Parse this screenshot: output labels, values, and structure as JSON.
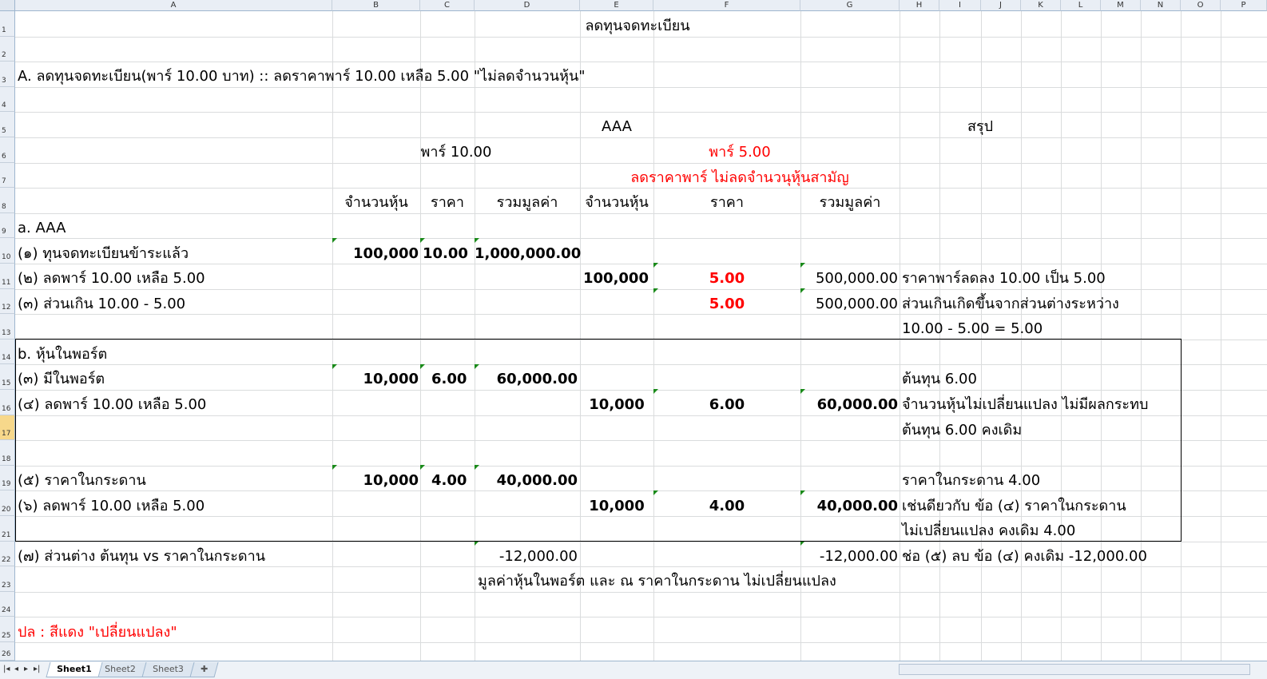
{
  "columns": [
    "A",
    "B",
    "C",
    "D",
    "E",
    "F",
    "G",
    "H",
    "I",
    "J",
    "K",
    "L",
    "M",
    "N",
    "O",
    "P"
  ],
  "rows": [
    "1",
    "2",
    "3",
    "4",
    "5",
    "6",
    "7",
    "8",
    "9",
    "10",
    "11",
    "12",
    "13",
    "14",
    "15",
    "16",
    "17",
    "18",
    "19",
    "20",
    "21",
    "22",
    "23",
    "24",
    "25",
    "26"
  ],
  "cells": {
    "title": "ลดทุนจดทะเบียน",
    "section_a_heading": "A. ลดทุนจดทะเบียน(พาร์ 10.00 บาท) ::   ลดราคาพาร์ 10.00 เหลือ 5.00  \"ไม่ลดจำนวนหุ้น\"",
    "aaa_header": "AAA",
    "summary_header": "สรุป",
    "par_old": "พาร์ 10.00",
    "par_new": "พาร์ 5.00",
    "par_note": "ลดราคาพาร์ ไม่ลดจำนวนุหุ้นสามัญ",
    "hdr_shares_1": "จำนวนหุ้น",
    "hdr_price_1": "ราคา",
    "hdr_total_1": "รวมมูลค่า",
    "hdr_shares_2": "จำนวนหุ้น",
    "hdr_price_2": "ราคา",
    "hdr_total_2": "รวมมูลค่า",
    "a9": "a. AAA",
    "a10": "(๑) ทุนจดทะเบียนข้าระแล้ว",
    "b10": "100,000",
    "c10": "10.00",
    "d10": "1,000,000.00",
    "a11": "(๒) ลดพาร์ 10.00 เหลือ 5.00",
    "e11": "100,000",
    "f11": "5.00",
    "g11": "500,000.00",
    "h11": "ราคาพาร์ลดลง 10.00 เป็น 5.00",
    "a12": "(๓) ส่วนเกิน 10.00 - 5.00",
    "f12": "5.00",
    "g12": "500,000.00",
    "h12": "ส่วนเกินเกิดขึ้นจากส่วนต่างระหว่าง",
    "h13": "10.00 - 5.00 = 5.00",
    "a14": "b. หุ้นในพอร์ต",
    "a15": "(๓) มีในพอร์ต",
    "b15": "10,000",
    "c15": "6.00",
    "d15": "60,000.00",
    "h15": "ต้นทุน 6.00",
    "a16": "(๔) ลดพาร์ 10.00 เหลือ 5.00",
    "e16": "10,000",
    "f16": "6.00",
    "g16": "60,000.00",
    "h16": "จำนวนหุ้นไม่เปลี่ยนแปลง ไม่มีผลกระทบ",
    "h17": "ต้นทุน 6.00 คงเดิม",
    "a19": "(๕) ราคาในกระดาน",
    "b19": "10,000",
    "c19": "4.00",
    "d19": "40,000.00",
    "h19": "ราคาในกระดาน 4.00",
    "a20": "(๖) ลดพาร์ 10.00 เหลือ 5.00",
    "e20": "10,000",
    "f20": "4.00",
    "g20": "40,000.00",
    "h20": "เช่นดียวกับ ข้อ (๔)  ราคาในกระดาน",
    "h21": "ไม่เปลี่ยนแปลง คงเดิม 4.00",
    "a22": "(๗) ส่วนต่าง ต้นทุน vs ราคาในกระดาน",
    "d22": "-12,000.00",
    "g22": "-12,000.00",
    "h22": "ช่อ (๕) ลบ ข้อ (๔) คงเดิม -12,000.00",
    "d23": "มูลค่าหุ้นในพอร์ต และ ณ ราคาในกระดาน ไม่เปลี่ยนแปลง",
    "a25": "ปล :  สีแดง \"เปลี่ยนแปลง\""
  },
  "sheet_tabs": [
    "Sheet1",
    "Sheet2",
    "Sheet3"
  ],
  "active_tab": "Sheet1",
  "colors": {
    "red": "#ff0000",
    "header_bg": "#e9eef5",
    "gridline": "#dadcdd",
    "selected_row": "#f7d88b",
    "comment_marker": "#1a8a1a"
  }
}
